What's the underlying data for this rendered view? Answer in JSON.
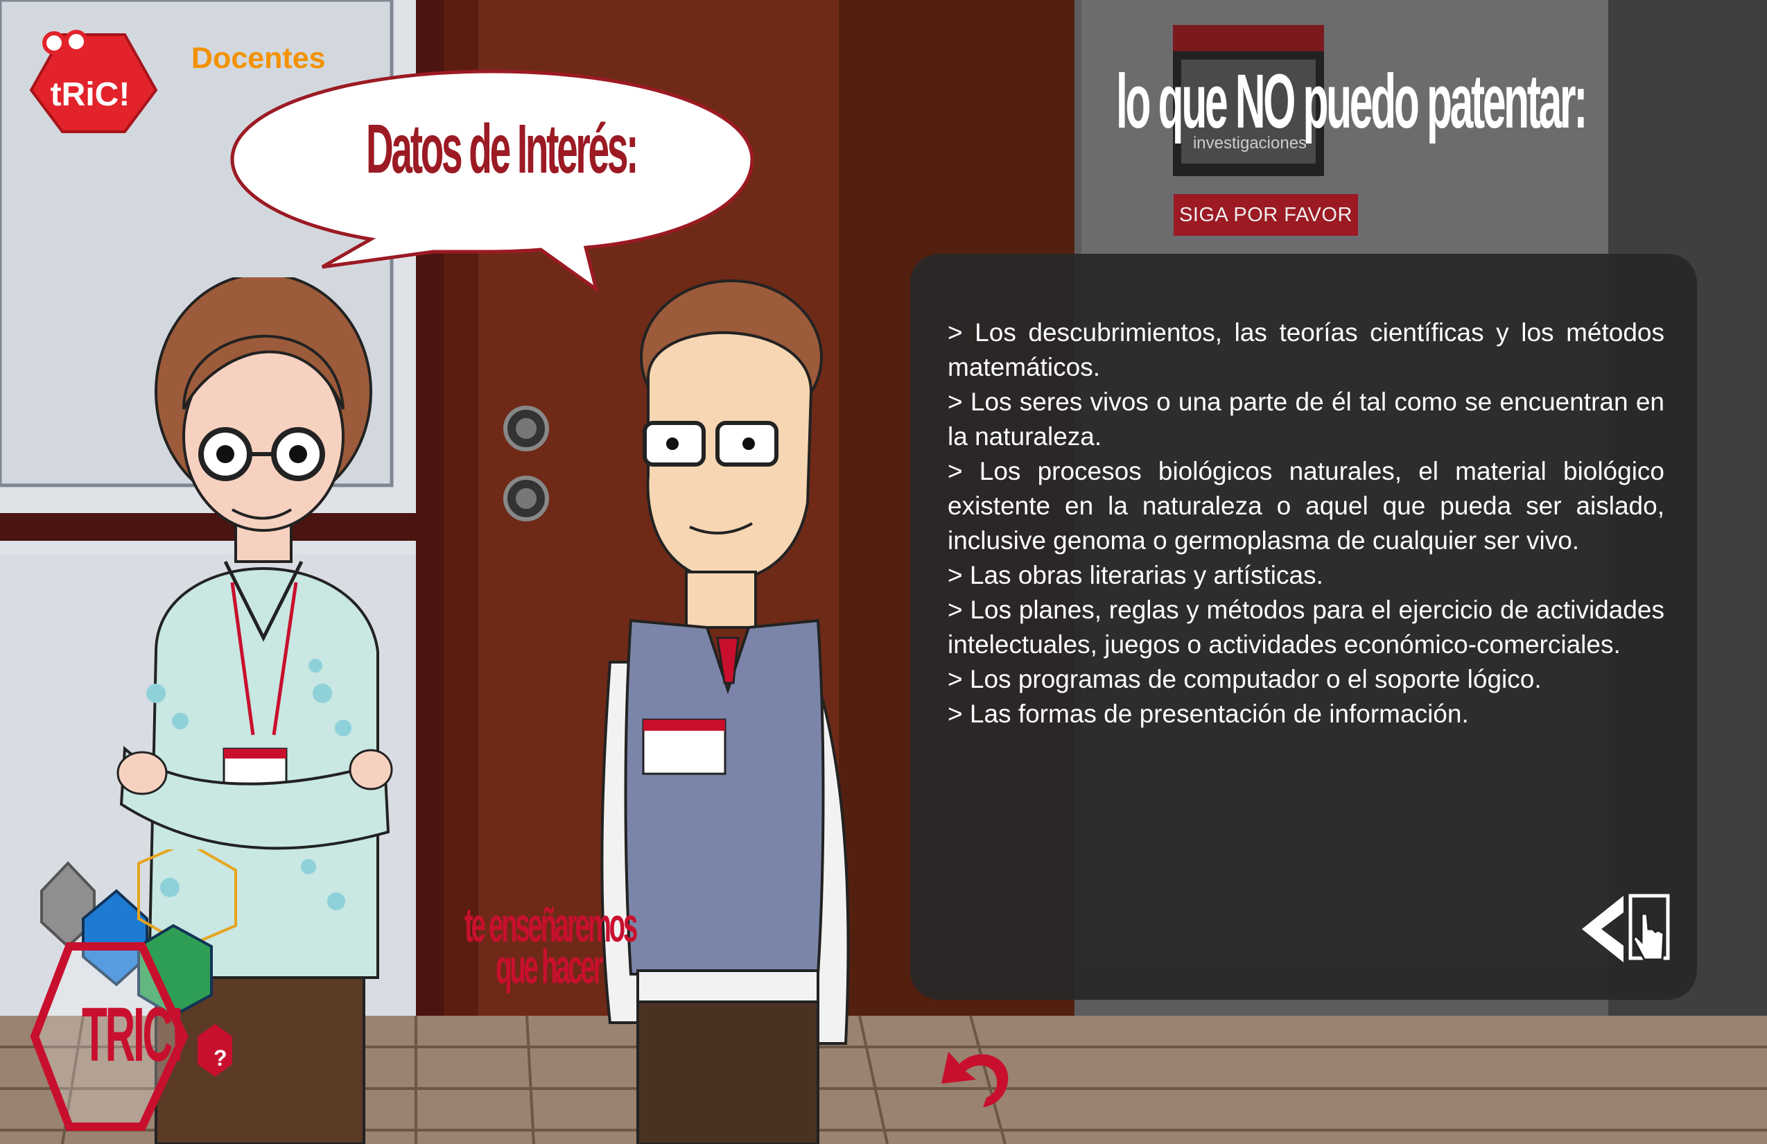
{
  "app": {
    "logo_text": "tRiC!",
    "section_label": "Docentes"
  },
  "speech_bubble": {
    "title": "Datos de Interés:"
  },
  "header": {
    "title": "lo que NO puedo patentar:",
    "sign_text": "investigaciones",
    "button_label": "SIGA POR FAVOR"
  },
  "info": {
    "items": [
      "> Los descubrimientos, las teorías científicas y los métodos matemáticos.",
      "> Los seres vivos o una parte de él tal como se encuentran en la naturaleza.",
      "> Los procesos biológicos naturales, el material biológico existente en la naturaleza o aquel que pueda ser aislado, inclusive genoma o germoplasma de cualquier ser vivo.",
      "> Las obras literarias y artísticas.",
      "> Los planes, reglas y métodos para el ejercicio de actividades intelectuales, juegos o actividades económico-comerciales.",
      "> Los programas de computador o el soporte lógico.",
      "> Las formas de presentación de información."
    ]
  },
  "poster": {
    "line1": "te enseñaremos",
    "line2": "que hacer"
  },
  "menu": {
    "tric_label": "TRIC!",
    "help_label": "?"
  },
  "colors": {
    "accent_red": "#9b1a23",
    "orange": "#f39200",
    "door": "#6e2a17"
  }
}
